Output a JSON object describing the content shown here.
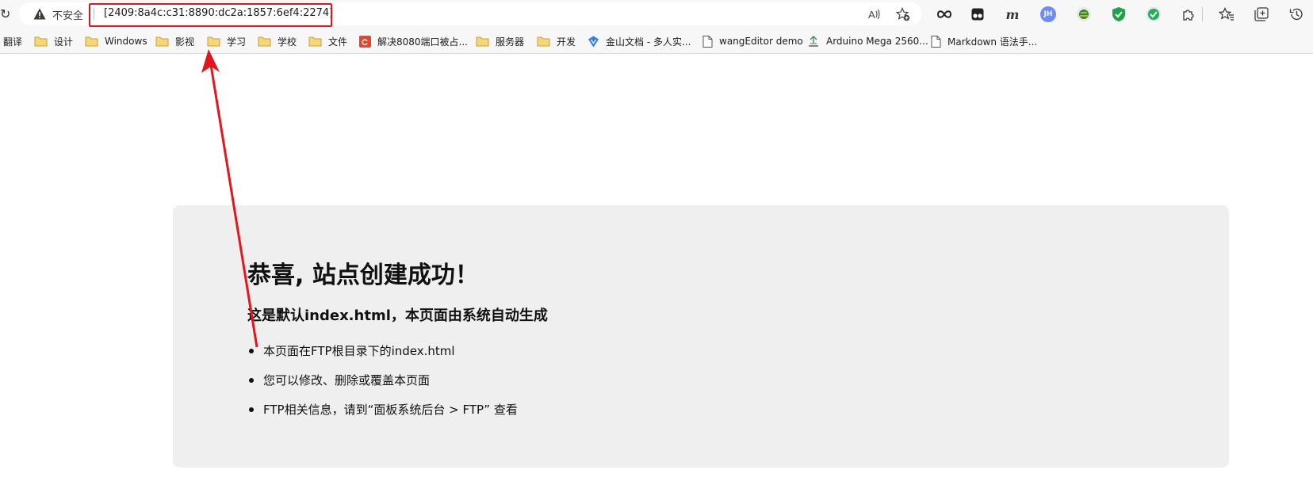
{
  "addressbar": {
    "security_label": "不安全",
    "url": "[2409:8a4c:c31:8890:dc2a:1857:6ef4:2274]"
  },
  "toolbar": {
    "icons": [
      "read-aloud-icon",
      "add-favorite-icon",
      "infinity-extension-icon",
      "tampermonkey-icon",
      "m-extension-icon",
      "jh-extension-icon",
      "globe-extension-icon",
      "shield-extension-icon",
      "check-extension-icon",
      "extensions-icon",
      "favorites-icon",
      "collections-icon",
      "history-icon"
    ],
    "m_label": "m",
    "jh_label": "JH"
  },
  "bookmarks": [
    {
      "label": "翻译",
      "icon": "none"
    },
    {
      "label": "设计",
      "icon": "folder-icon"
    },
    {
      "label": "Windows",
      "icon": "folder-icon"
    },
    {
      "label": "影视",
      "icon": "folder-icon"
    },
    {
      "label": "学习",
      "icon": "folder-icon"
    },
    {
      "label": "学校",
      "icon": "folder-icon"
    },
    {
      "label": "文件",
      "icon": "folder-icon"
    },
    {
      "label": "解决8080端口被占...",
      "icon": "csdn-icon"
    },
    {
      "label": "服务器",
      "icon": "folder-icon"
    },
    {
      "label": "开发",
      "icon": "folder-icon"
    },
    {
      "label": "金山文档 - 多人实...",
      "icon": "kdocs-icon"
    },
    {
      "label": "wangEditor demo",
      "icon": "page-icon"
    },
    {
      "label": "Arduino Mega 2560...",
      "icon": "arduino-icon"
    },
    {
      "label": "Markdown 语法手...",
      "icon": "page-icon"
    }
  ],
  "page": {
    "title": "恭喜, 站点创建成功！",
    "subtitle": "这是默认index.html，本页面由系统自动生成",
    "items": [
      "本页面在FTP根目录下的index.html",
      "您可以修改、删除或覆盖本页面",
      "FTP相关信息，请到“面板系统后台 > FTP” 查看"
    ]
  },
  "colors": {
    "annotation": "#e4161b",
    "card_background": "#efefef",
    "folder": "#f2c55c"
  }
}
